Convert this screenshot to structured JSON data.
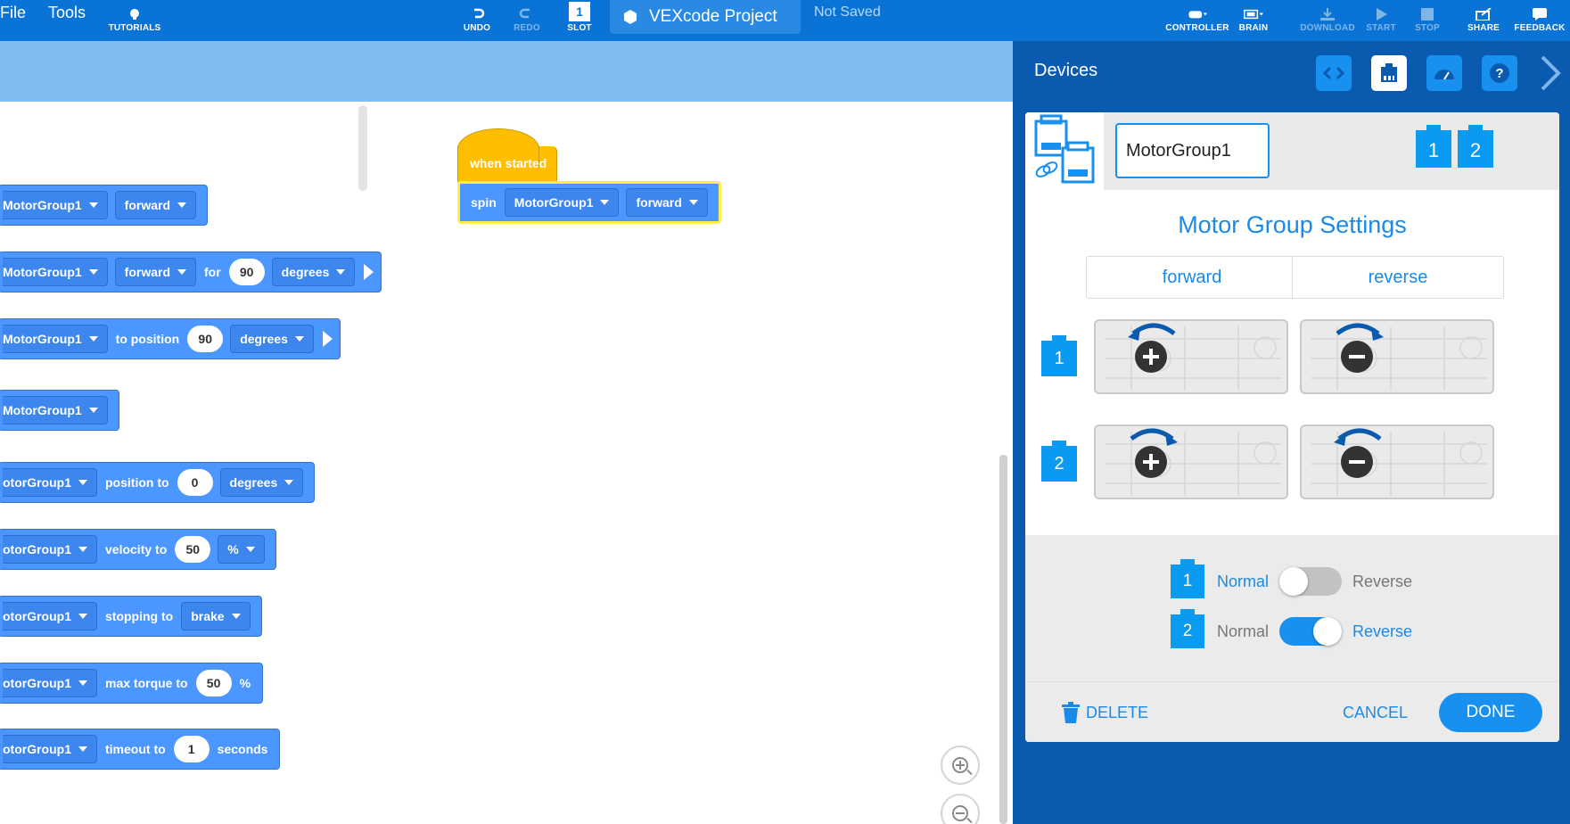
{
  "menu": {
    "file": "File",
    "tools": "Tools"
  },
  "toolbar": {
    "tutorials": "TUTORIALS",
    "undo": "UNDO",
    "redo": "REDO",
    "slot": "SLOT",
    "slot_number": "1",
    "project_name": "VEXcode Project",
    "save_status": "Not Saved",
    "controller": "CONTROLLER",
    "brain": "BRAIN",
    "download": "DOWNLOAD",
    "start": "START",
    "stop": "STOP",
    "share": "SHARE",
    "feedback": "FEEDBACK"
  },
  "palette": {
    "blocks": [
      {
        "device": "MotorGroup1",
        "parts": [
          {
            "t": "dd",
            "v": "forward"
          }
        ]
      },
      {
        "device": "MotorGroup1",
        "parts": [
          {
            "t": "dd",
            "v": "forward"
          },
          {
            "t": "txt",
            "v": "for"
          },
          {
            "t": "num",
            "v": "90"
          },
          {
            "t": "dd",
            "v": "degrees"
          },
          {
            "t": "play"
          }
        ]
      },
      {
        "device": "MotorGroup1",
        "parts": [
          {
            "t": "txt",
            "v": "to position"
          },
          {
            "t": "num",
            "v": "90"
          },
          {
            "t": "dd",
            "v": "degrees"
          },
          {
            "t": "play"
          }
        ]
      },
      {
        "device": "MotorGroup1",
        "parts": []
      },
      {
        "device": "otorGroup1",
        "parts": [
          {
            "t": "txt",
            "v": "position to"
          },
          {
            "t": "num",
            "v": "0"
          },
          {
            "t": "dd",
            "v": "degrees"
          }
        ]
      },
      {
        "device": "otorGroup1",
        "parts": [
          {
            "t": "txt",
            "v": "velocity to"
          },
          {
            "t": "num",
            "v": "50"
          },
          {
            "t": "dd",
            "v": "%"
          }
        ]
      },
      {
        "device": "otorGroup1",
        "parts": [
          {
            "t": "txt",
            "v": "stopping to"
          },
          {
            "t": "dd",
            "v": "brake"
          }
        ]
      },
      {
        "device": "otorGroup1",
        "parts": [
          {
            "t": "txt",
            "v": "max torque to"
          },
          {
            "t": "num",
            "v": "50"
          },
          {
            "t": "txt",
            "v": "%"
          }
        ]
      },
      {
        "device": "otorGroup1",
        "parts": [
          {
            "t": "txt",
            "v": "timeout to"
          },
          {
            "t": "num",
            "v": "1"
          },
          {
            "t": "txt",
            "v": "seconds"
          }
        ]
      }
    ]
  },
  "workspace": {
    "hat_label": "when started",
    "spin_label": "spin",
    "spin_device": "MotorGroup1",
    "spin_direction": "forward"
  },
  "devices": {
    "title": "Devices",
    "device_name": "MotorGroup1",
    "port_1": "1",
    "port_2": "2",
    "settings_title": "Motor Group Settings",
    "forward_label": "forward",
    "reverse_label": "reverse",
    "motor_1": "1",
    "motor_2": "2",
    "normal_label": "Normal",
    "reverse_toggle_label": "Reverse",
    "motor_1_reversed": false,
    "motor_2_reversed": true,
    "delete_label": "DELETE",
    "cancel_label": "CANCEL",
    "done_label": "DONE"
  },
  "colors": {
    "topbar": "#0a74d6",
    "accent": "#1890ef",
    "block": "#4c97ff",
    "hat": "#ffbf00",
    "panel": "#0a5ab0"
  }
}
